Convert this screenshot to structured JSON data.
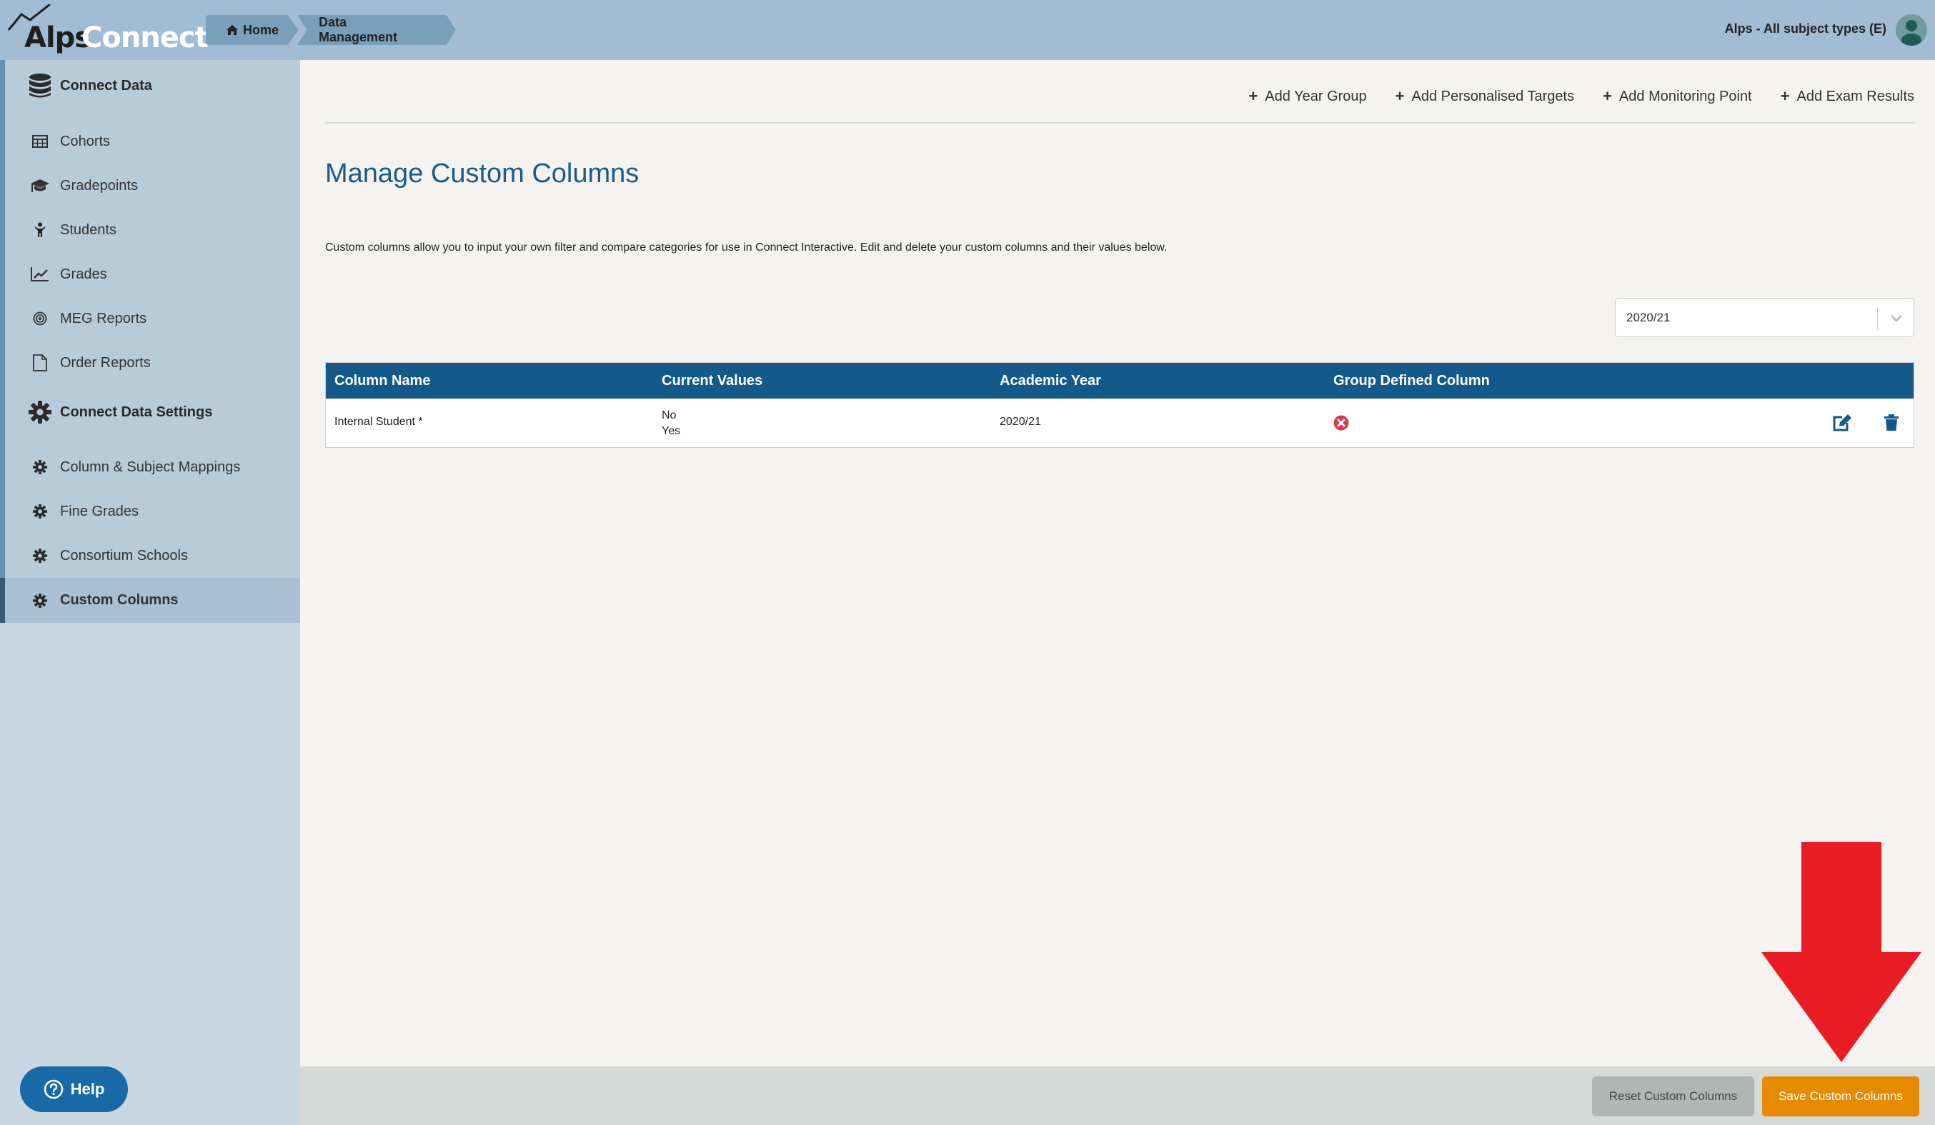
{
  "header": {
    "logo_primary": "Alps",
    "logo_secondary": "Connect",
    "breadcrumb": [
      {
        "label": "Home",
        "icon": "home-icon"
      },
      {
        "label": "Data Management"
      }
    ],
    "user_label": "Alps - All subject types (E)",
    "avatar_icon": "user-avatar-icon"
  },
  "sidebar": {
    "sections": [
      {
        "label": "Connect Data",
        "icon": "database-icon"
      },
      {
        "label": "Connect Data Settings",
        "icon": "gear-icon"
      }
    ],
    "items": [
      {
        "label": "Cohorts",
        "icon": "table-icon"
      },
      {
        "label": "Gradepoints",
        "icon": "graduation-cap-icon"
      },
      {
        "label": "Students",
        "icon": "child-icon"
      },
      {
        "label": "Grades",
        "icon": "line-chart-icon"
      },
      {
        "label": "MEG Reports",
        "icon": "target-icon"
      },
      {
        "label": "Order Reports",
        "icon": "file-icon"
      },
      {
        "label": "Column & Subject Mappings",
        "icon": "gear-icon"
      },
      {
        "label": "Fine Grades",
        "icon": "gear-icon"
      },
      {
        "label": "Consortium Schools",
        "icon": "gear-icon"
      },
      {
        "label": "Custom Columns",
        "icon": "gear-icon",
        "active": true
      }
    ],
    "help_label": "Help"
  },
  "main": {
    "actions": [
      {
        "label": "Add Year Group"
      },
      {
        "label": "Add Personalised Targets"
      },
      {
        "label": "Add Monitoring Point"
      },
      {
        "label": "Add Exam Results"
      }
    ],
    "title": "Manage Custom Columns",
    "description": "Custom columns allow you to input your own filter and compare categories for use in Connect Interactive. Edit and delete your custom columns and their values below.",
    "year_select": {
      "value": "2020/21"
    },
    "table": {
      "columns": [
        "Column Name",
        "Current Values",
        "Academic Year",
        "Group Defined Column"
      ],
      "rows": [
        {
          "column_name": "Internal Student *",
          "current_values": [
            "No",
            "Yes"
          ],
          "academic_year": "2020/21",
          "group_defined": false
        }
      ]
    }
  },
  "footer": {
    "reset_label": "Reset Custom Columns",
    "save_label": "Save Custom Columns"
  },
  "colors": {
    "header_bg": "#a1bcd3",
    "table_header": "#135a8b",
    "title": "#1c5a8c",
    "save_button": "#e68a00",
    "help_button": "#176aa6",
    "annotation_arrow": "#ec1c24",
    "not_defined_icon": "#d9394a"
  }
}
